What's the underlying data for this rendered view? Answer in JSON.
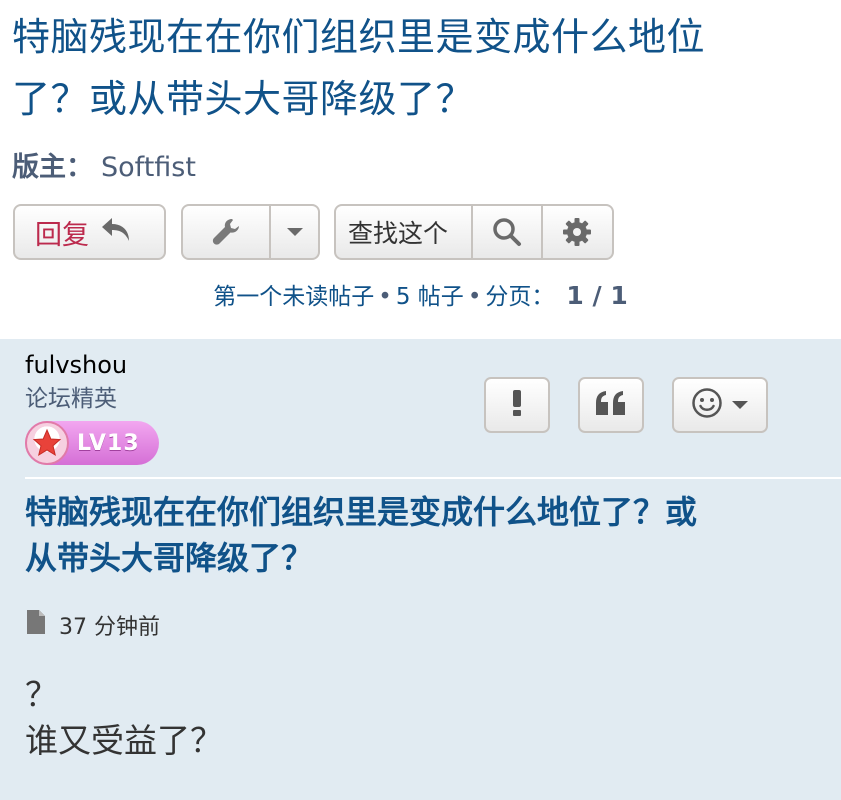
{
  "topic": {
    "title_line1": "特脑残现在在你们组织里是变成什么地位",
    "title_line2": "了？或从带头大哥降级了？"
  },
  "moderator": {
    "label": "版主：",
    "name": "Softfist"
  },
  "toolbar": {
    "reply_label": "回复",
    "search_placeholder": "查找这个"
  },
  "pagination": {
    "first_unread": "第一个未读帖子",
    "posts_count": "5 帖子",
    "page_label": "分页：",
    "page": "1 / 1"
  },
  "post": {
    "author": "fulvshou",
    "rank": "论坛精英",
    "level": "LV13",
    "title_line1": "特脑残现在在你们组织里是变成什么地位了？或",
    "title_line2": "从带头大哥降级了？",
    "time": "37 分钟前",
    "content_line1": "？",
    "content_line2": "谁又受益了？"
  },
  "colors": {
    "link": "#105289",
    "reply": "#bc2a4d",
    "post_bg": "#e1ebf2",
    "badge": "#d56fd6"
  },
  "icons": [
    "reply-arrow-icon",
    "wrench-icon",
    "caret-down-icon",
    "search-icon",
    "gear-icon",
    "exclamation-icon",
    "quote-icon",
    "smiley-icon",
    "star-icon",
    "document-icon"
  ]
}
